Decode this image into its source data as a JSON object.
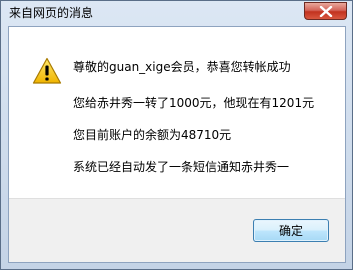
{
  "window": {
    "title": "来自网页的消息",
    "close_icon": "close-icon"
  },
  "dialog": {
    "icon": "warning-icon",
    "lines": [
      "尊敬的guan_xige会员，恭喜您转帐成功",
      "您给赤井秀一转了1000元，他现在有1201元",
      "您目前账户的余额为48710元",
      "系统已经自动发了一条短信通知赤井秀一"
    ]
  },
  "buttons": {
    "ok_label": "确定"
  },
  "colors": {
    "close_button": "#c2321f",
    "warning_yellow": "#f5c518",
    "ok_button_border": "#3c7fb1"
  }
}
